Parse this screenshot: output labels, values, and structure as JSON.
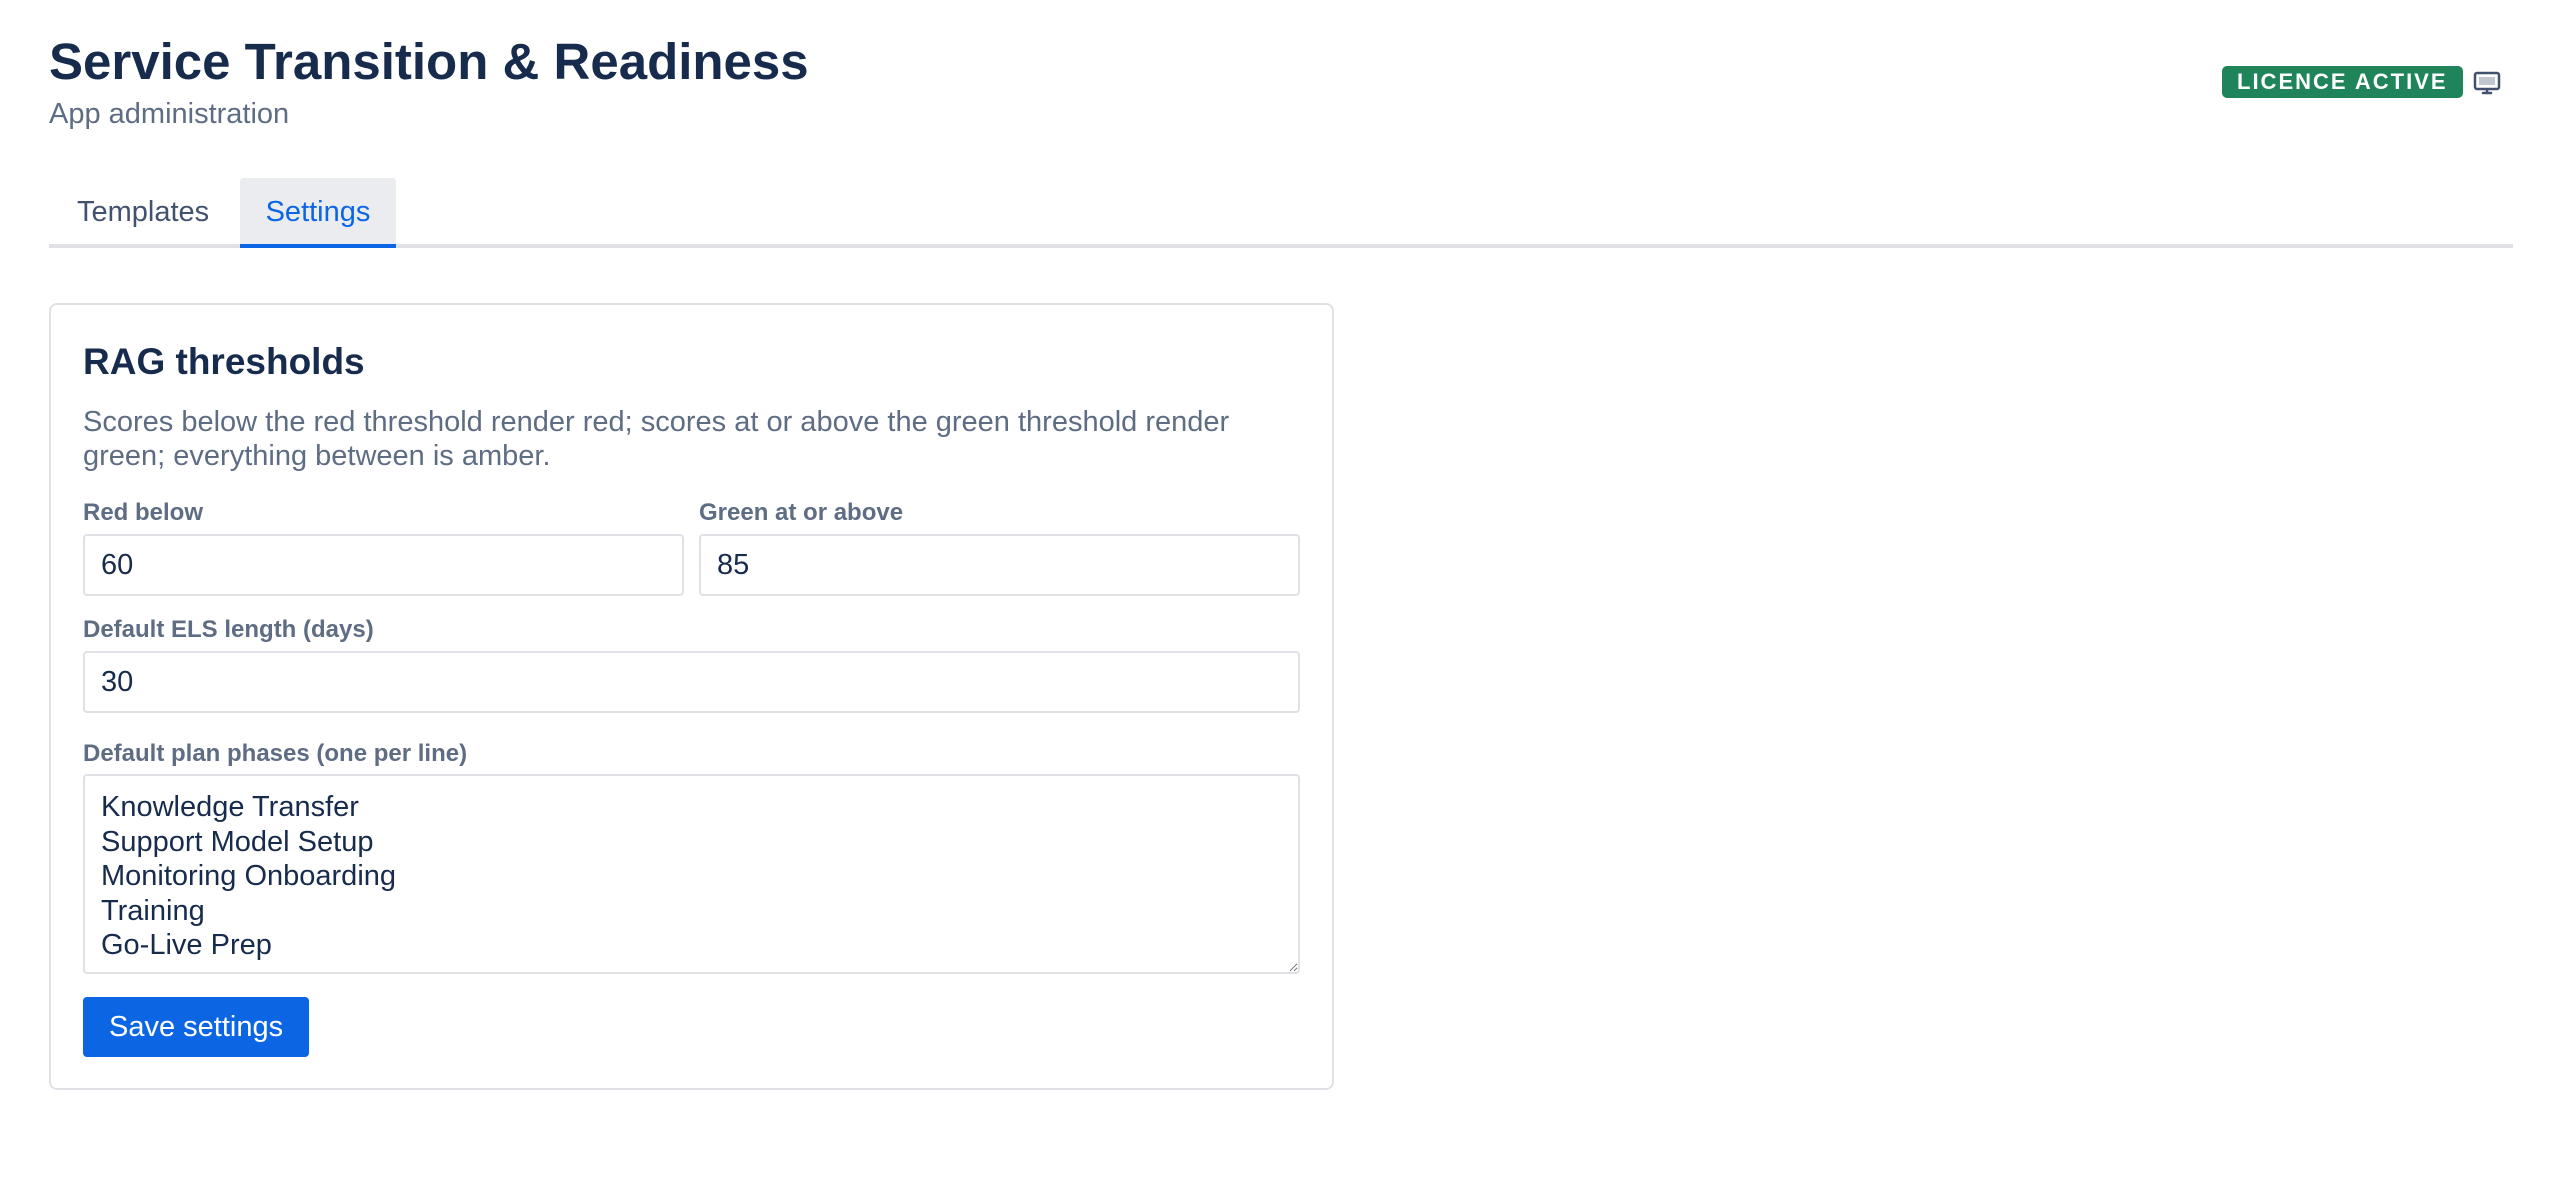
{
  "header": {
    "title": "Service Transition & Readiness",
    "subtitle": "App administration",
    "licence_badge": "LICENCE ACTIVE",
    "display_icon": "monitor-icon"
  },
  "tabs": [
    {
      "label": "Templates",
      "active": false
    },
    {
      "label": "Settings",
      "active": true
    }
  ],
  "rag_card": {
    "title": "RAG thresholds",
    "description": "Scores below the red threshold render red; scores at or above the green threshold render green; everything between is amber.",
    "red_below": {
      "label": "Red below",
      "value": "60"
    },
    "green_at_or_above": {
      "label": "Green at or above",
      "value": "85"
    },
    "default_els_length": {
      "label": "Default ELS length (days)",
      "value": "30"
    },
    "default_plan_phases": {
      "label": "Default plan phases (one per line)",
      "value": "Knowledge Transfer\nSupport Model Setup\nMonitoring Onboarding\nTraining\nGo-Live Prep"
    },
    "save_label": "Save settings"
  },
  "colors": {
    "primary": "#0c66e4",
    "licence_badge_bg": "#1f845a",
    "heading_text": "#172b4d",
    "muted_text": "#5e6c84",
    "border": "#dfe1e6",
    "active_tab_bg": "#ebecf0"
  }
}
